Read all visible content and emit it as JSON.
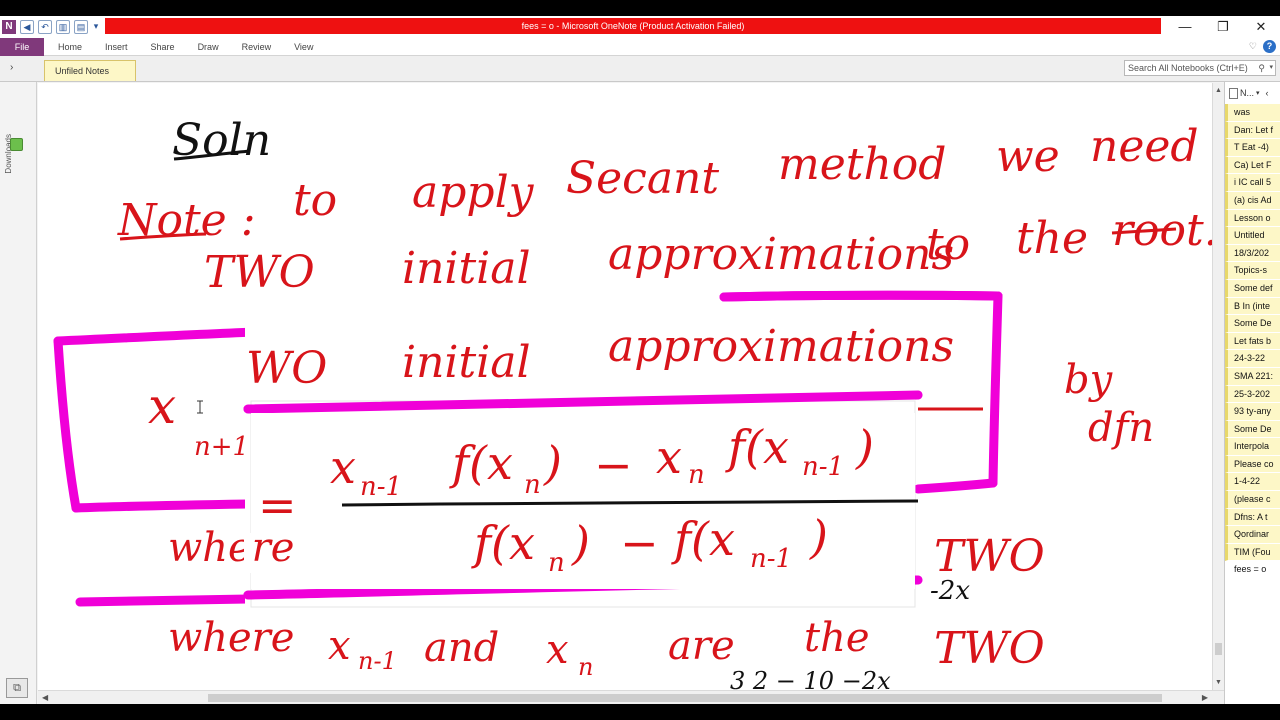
{
  "window": {
    "title": "fees = o  -  Microsoft OneNote (Product Activation Failed)",
    "controls": [
      "—",
      "❐",
      "✕"
    ]
  },
  "ribbon": {
    "file_label": "File",
    "tabs": [
      "Home",
      "Insert",
      "Share",
      "Draw",
      "Review",
      "View"
    ]
  },
  "notebook": {
    "section_tab": "Unfiled Notes",
    "sidebar_label": "Downloads",
    "search_placeholder": "Search All Notebooks (Ctrl+E)"
  },
  "pages_panel": {
    "header": "N...",
    "items": [
      "was",
      "Dan: Let f",
      "T Eat -4)",
      "Ca) Let F",
      "i IC call 5",
      "(a) cis Ad",
      "Lesson o",
      "Untitled",
      "18/3/202",
      "Topics-s",
      "Some def",
      "B In (inte",
      "Some De",
      "Let fats b",
      "24-3-22",
      "SMA 221:",
      "25-3-202",
      "93 ty-any",
      "Some De",
      "Interpola",
      "Please co",
      "1-4-22",
      "(please c",
      "Dfns: A t",
      "Qordinar",
      "TIM (Fou",
      "fees = o"
    ],
    "active_index": 26
  },
  "ink": {
    "heading": "Soln",
    "note_line1": [
      "Note :",
      "to",
      "apply",
      "Secant",
      "method",
      "we",
      "need"
    ],
    "note_line2": [
      "TWO",
      "initial",
      "approximations",
      "to",
      "the",
      "root."
    ],
    "echo_line": [
      "WO",
      "initial",
      "approximations"
    ],
    "lhs": "x",
    "lhs_sub": "n+1",
    "equals": "=",
    "numerator_a": "x",
    "numerator_a_sub": "n-1",
    "numerator_b": "f(x",
    "numerator_b_sub": "n",
    "numerator_b_close": ")",
    "minus": "−",
    "numerator_c": "x",
    "numerator_c_sub": "n",
    "numerator_d": "f(x",
    "numerator_d_sub": "n-1",
    "numerator_d_close": ")",
    "denominator_a": "f(x",
    "denominator_a_sub": "n",
    "denominator_b": "f(x",
    "denominator_b_sub": "n-1",
    "by_label": "by",
    "dfn_label": "dfn",
    "where_1": "where",
    "where_2": "where",
    "xn1": "x",
    "xn1_sub": "n-1",
    "and_word": "and",
    "xn": "x",
    "xn_sub": "n",
    "are_word": "are",
    "the_word": "the",
    "two_1": "TWO",
    "two_2": "TWO",
    "black_1": "-2x",
    "black_2": "3    2 − 10 −2x"
  },
  "colors": {
    "ink_red": "#d8141a",
    "ink_black": "#111111",
    "highlight_magenta": "#f000d8",
    "onenote_purple": "#80397b",
    "title_red": "#ee1111"
  }
}
